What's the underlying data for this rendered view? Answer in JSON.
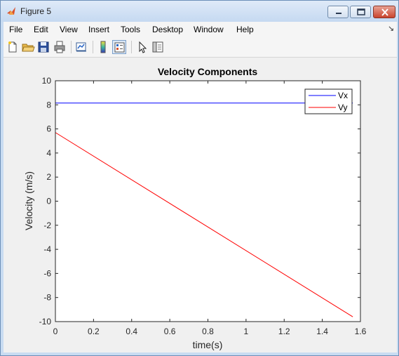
{
  "window": {
    "title": "Figure 5",
    "buttons": [
      "minimize",
      "maximize",
      "close"
    ]
  },
  "menubar": {
    "items": [
      "File",
      "Edit",
      "View",
      "Insert",
      "Tools",
      "Desktop",
      "Window",
      "Help"
    ]
  },
  "toolbar": {
    "icons": [
      "new-figure-icon",
      "open-file-icon",
      "save-icon",
      "print-icon",
      "link-plot-icon",
      "colorbar-icon",
      "legend-icon",
      "pointer-icon",
      "property-editor-icon"
    ]
  },
  "chart_data": {
    "type": "line",
    "title": "Velocity Components",
    "xlabel": "time(s)",
    "ylabel": "Velocity (m/s)",
    "xlim": [
      0,
      1.6
    ],
    "ylim": [
      -10,
      10
    ],
    "xticks": [
      "0",
      "0.2",
      "0.4",
      "0.6",
      "0.8",
      "1",
      "1.2",
      "1.4",
      "1.6"
    ],
    "yticks": [
      "-10",
      "-8",
      "-6",
      "-4",
      "-2",
      "0",
      "2",
      "4",
      "6",
      "8",
      "10"
    ],
    "grid": false,
    "legend_position": "top-right",
    "series": [
      {
        "name": "Vx",
        "color": "#0000ff",
        "x": [
          0,
          1.56
        ],
        "y": [
          8.15,
          8.15
        ]
      },
      {
        "name": "Vy",
        "color": "#ff0000",
        "x": [
          0,
          1.56
        ],
        "y": [
          5.7,
          -9.6
        ]
      }
    ]
  }
}
